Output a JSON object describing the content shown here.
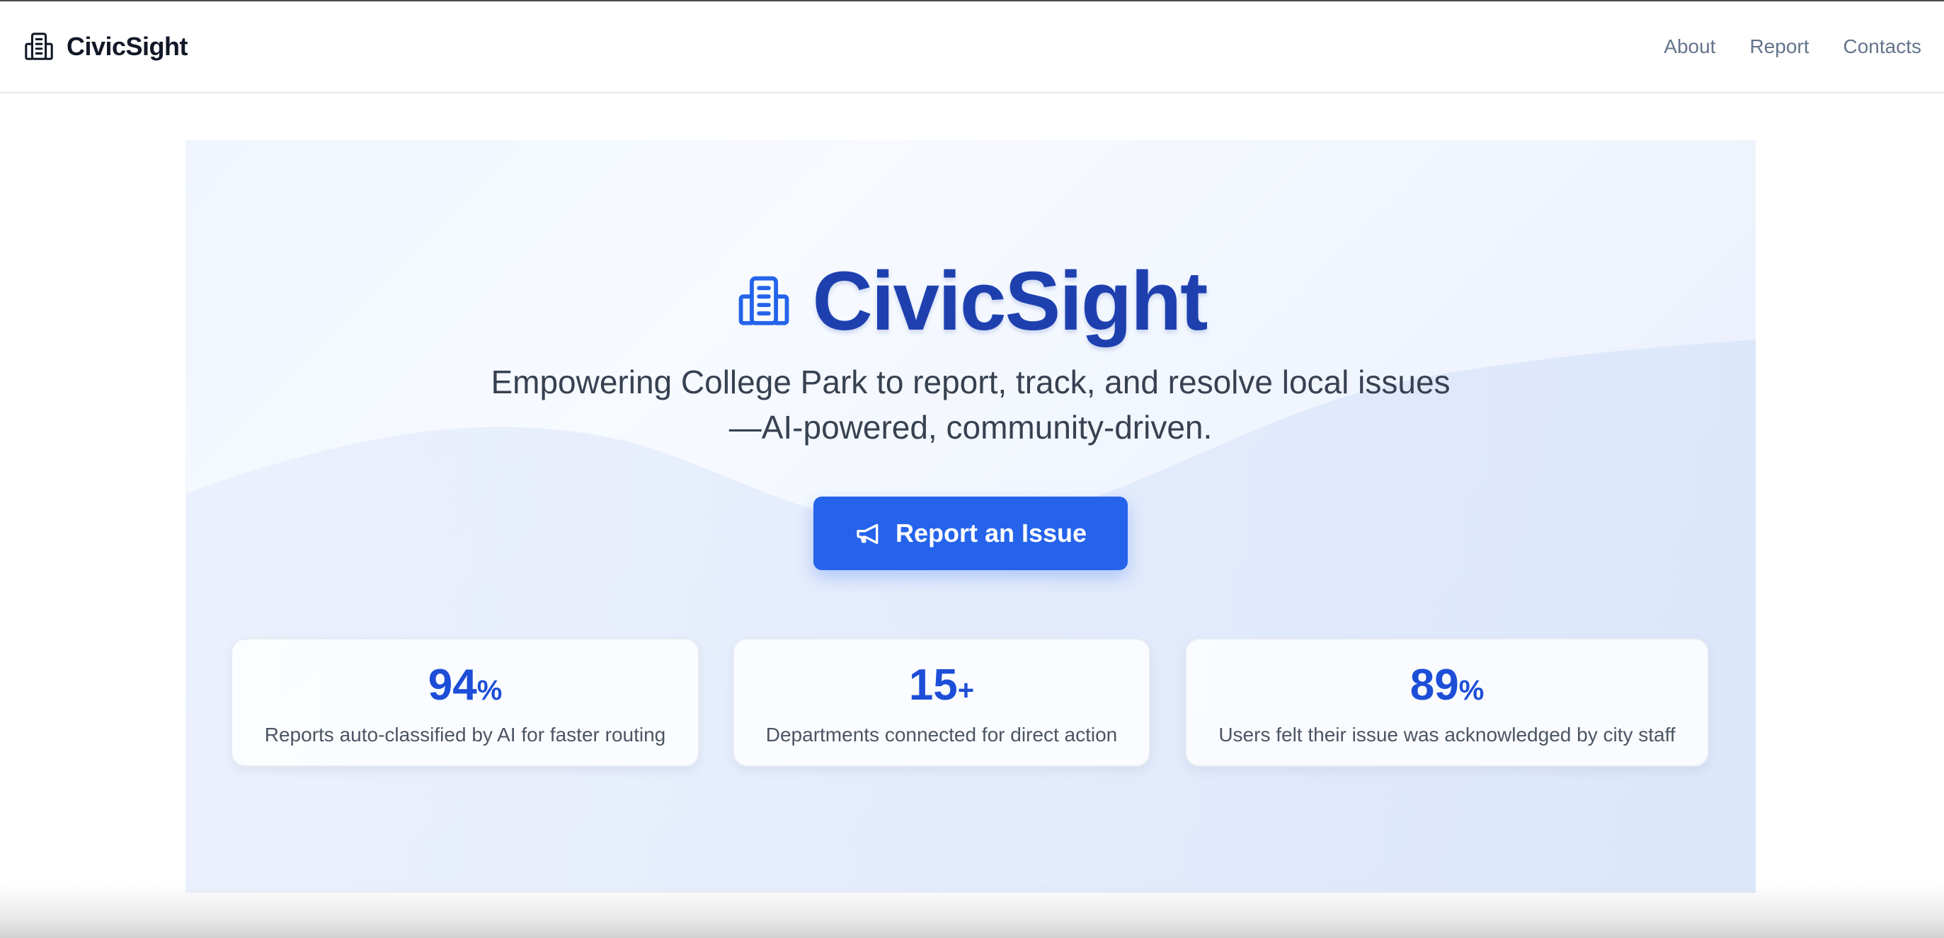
{
  "navbar": {
    "brand": "CivicSight",
    "brand_icon": "building-icon",
    "links": [
      "About",
      "Report",
      "Contacts"
    ]
  },
  "hero": {
    "title": "CivicSight",
    "title_icon": "building-icon",
    "tagline_line1": "Empowering College Park to report, track, and resolve local issues",
    "tagline_line2": "—AI-powered, community-driven.",
    "cta_label": "Report an Issue",
    "cta_icon": "megaphone-icon"
  },
  "stats": [
    {
      "value": "94",
      "suffix": "%",
      "label": "Reports auto-classified by AI for faster routing"
    },
    {
      "value": "15",
      "suffix": "+",
      "label": "Departments connected for direct action"
    },
    {
      "value": "89",
      "suffix": "%",
      "label": "Users felt their issue was acknowledged by city staff"
    }
  ],
  "colors": {
    "accent": "#2563eb",
    "title": "#1e40af",
    "stat_value": "#1d4ed8",
    "nav_text": "#64748b"
  }
}
